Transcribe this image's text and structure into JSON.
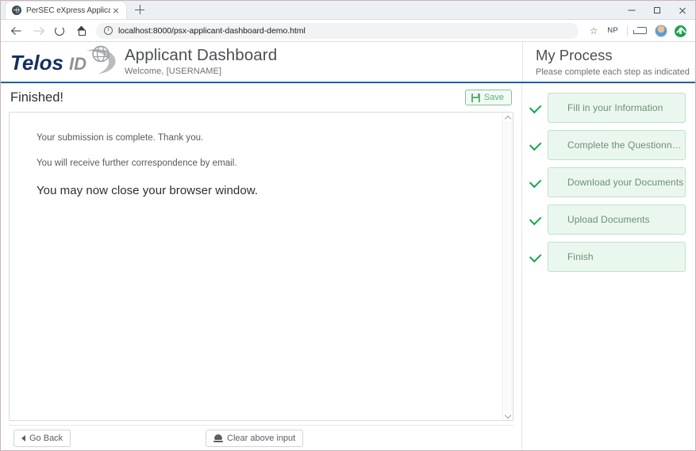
{
  "browser": {
    "tab": {
      "title": "PerSEC eXpress Applicant Dashb",
      "favicon": "globe-icon",
      "close": "close-icon"
    },
    "new_tab_label": "new-tab-icon",
    "window_controls": {
      "minimize": "minimize-icon",
      "maximize": "maximize-icon",
      "close": "close-icon"
    },
    "nav": {
      "back": "back-arrow-icon",
      "forward": "forward-arrow-icon",
      "reload": "reload-icon",
      "home": "home-icon"
    },
    "omnibox": {
      "info": "info-icon",
      "url": "localhost:8000/psx-applicant-dashboard-demo.html"
    },
    "toolbar_right": {
      "bookmark": "star-icon",
      "profile_initials": "NP",
      "cast": "cast-icon",
      "avatar": "avatar-icon",
      "extension": "green-download-icon"
    }
  },
  "header": {
    "logo_alt": "Telos ID",
    "logo_word_1": "Telos",
    "logo_word_2": "ID",
    "title": "Applicant Dashboard",
    "welcome": "Welcome, [USERNAME]",
    "process_title": "My Process",
    "process_subtitle": "Please complete each step as indicated",
    "accent_color": "#1f5fa9"
  },
  "main": {
    "heading": "Finished!",
    "save_label": "Save",
    "save_icon": "save-floppy-icon",
    "body": {
      "line1": "Your submission is complete. Thank you.",
      "line2": "You will receive further correspondence by email.",
      "line3": "You may now close your browser window."
    },
    "scrollbar": {
      "up": "scroll-up-arrow-icon",
      "down": "scroll-down-arrow-icon"
    }
  },
  "footer": {
    "go_back_label": "Go Back",
    "go_back_icon": "left-triangle-icon",
    "clear_label": "Clear above input",
    "clear_icon": "eraser-icon"
  },
  "process": {
    "check_color": "#17a84b",
    "pill_bg": "#eaf7ee",
    "pill_border": "#bfe3c9",
    "steps": [
      {
        "label": "Fill in your Information",
        "status": "complete"
      },
      {
        "label": "Complete the Questionnaire",
        "status": "complete"
      },
      {
        "label": "Download your Documents",
        "status": "complete"
      },
      {
        "label": "Upload Documents",
        "status": "complete"
      },
      {
        "label": "Finish",
        "status": "complete"
      }
    ]
  }
}
